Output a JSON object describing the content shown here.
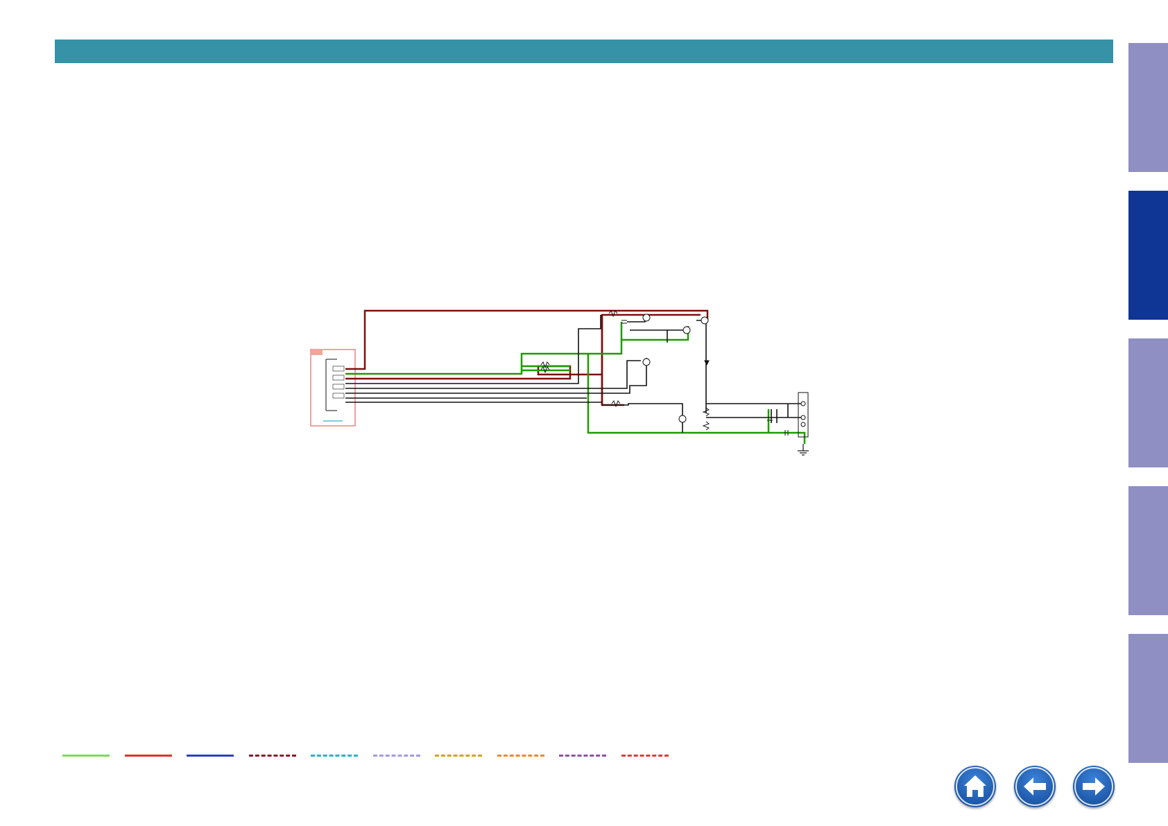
{
  "header": {
    "color": "#3592a7"
  },
  "side_tabs": [
    {
      "name": "side-tab-1",
      "active": false
    },
    {
      "name": "side-tab-2",
      "active": true
    },
    {
      "name": "side-tab-3",
      "active": false
    },
    {
      "name": "side-tab-4",
      "active": false
    },
    {
      "name": "side-tab-5",
      "active": false
    }
  ],
  "colors": {
    "tab_inactive": "#8f8fc4",
    "tab_active": "#0f3595",
    "wire_dark_red": "#7f0d0d",
    "wire_green": "#1f9a00",
    "wire_black": "#111111",
    "connector_box": "#f08080",
    "nav_button": "#1d57a8"
  },
  "legend": {
    "lines": [
      {
        "name": "legend-green-solid",
        "color": "#7ed957",
        "style": "solid"
      },
      {
        "name": "legend-red-solid",
        "color": "#d9342b",
        "style": "solid"
      },
      {
        "name": "legend-blue-solid",
        "color": "#2a3fbf",
        "style": "solid"
      },
      {
        "name": "legend-darkred-dashed",
        "color": "#8b1a2b",
        "style": "dashed"
      },
      {
        "name": "legend-cyan-dashed",
        "color": "#25b3c9",
        "style": "dashed"
      },
      {
        "name": "legend-lavender-dashed",
        "color": "#a49ae0",
        "style": "dashed"
      },
      {
        "name": "legend-gold-dashed",
        "color": "#d6a21a",
        "style": "dashed"
      },
      {
        "name": "legend-orange-dashed",
        "color": "#ea8a2a",
        "style": "dashed"
      },
      {
        "name": "legend-purple-dashed",
        "color": "#8e4fa6",
        "style": "dashed"
      },
      {
        "name": "legend-red-dashed",
        "color": "#e03a3a",
        "style": "dashed"
      }
    ]
  },
  "nav": {
    "buttons": [
      {
        "name": "home-button",
        "icon": "home-icon"
      },
      {
        "name": "back-button",
        "icon": "arrow-left-icon"
      },
      {
        "name": "forward-button",
        "icon": "arrow-right-icon"
      }
    ]
  }
}
